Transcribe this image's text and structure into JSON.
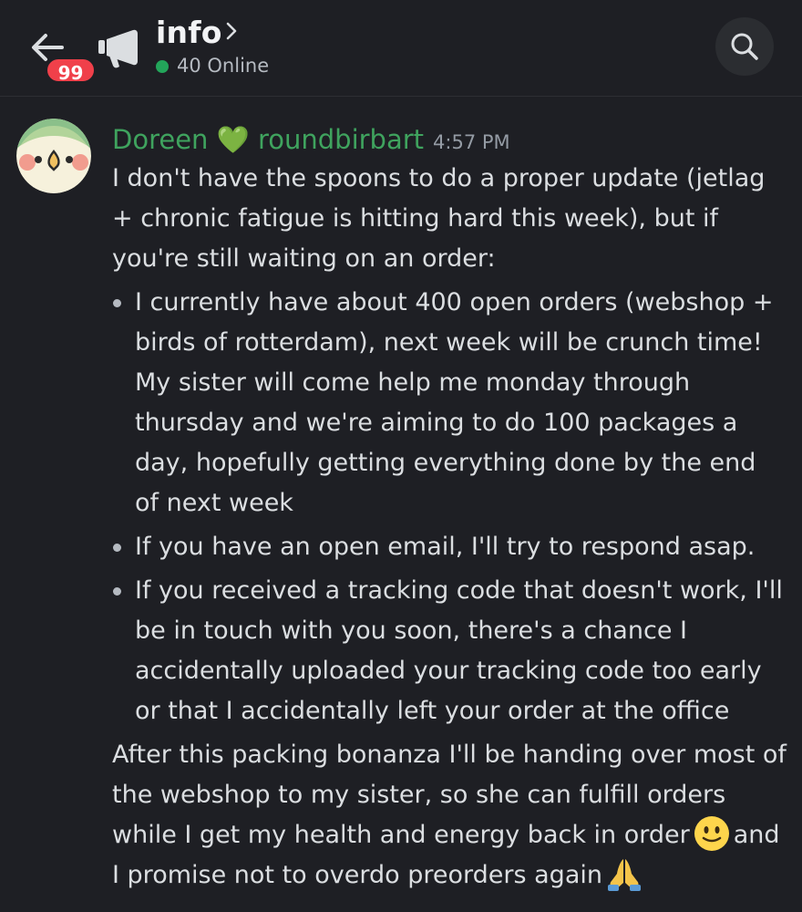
{
  "header": {
    "channel_name": "info",
    "unread_count": "99",
    "online_count": "40 Online",
    "icons": {
      "back": "back-arrow-icon",
      "channel_type": "megaphone-icon",
      "chevron": "chevron-right-icon",
      "search": "search-icon"
    }
  },
  "message": {
    "author": "Doreen 💚 roundbirbart",
    "timestamp": "4:57 PM",
    "intro": "I don't have the spoons to do a proper update (jetlag + chronic fatigue is hitting hard this week), but if you're still waiting on an order:",
    "bullets": [
      "I currently have about 400 open orders (webshop + birds of rotterdam), next week will be crunch time! My sister will come help me monday through thursday and we're aiming to do 100 packages a day, hopefully getting everything done by the end of next week",
      "If you have an open email, I'll try to respond asap.",
      "If you received a tracking code that doesn't work, I'll be in touch with you soon, there's a chance I accidentally uploaded your tracking code too early or that I accidentally left your order at the office"
    ],
    "outro_part1": "After this packing bonanza I'll be handing over most of the webshop to my sister, so she can fulfill orders while I get my health and energy back in order",
    "outro_part2": "and I promise not to overdo preorders again",
    "emojis": [
      "slightly-smiling-face",
      "folded-hands"
    ]
  },
  "colors": {
    "background": "#1e1f24",
    "author": "#3fa35e",
    "badge": "#f0404a",
    "online": "#23a55a"
  }
}
